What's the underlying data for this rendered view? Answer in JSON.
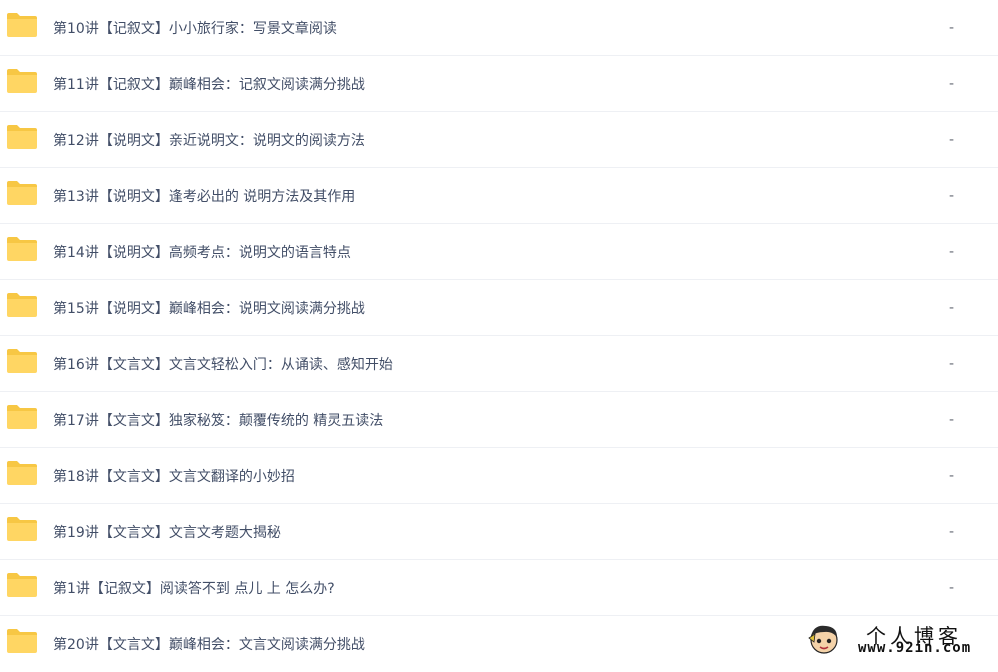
{
  "colors": {
    "folder_body": "#FFD663",
    "folder_tab": "#F7C744",
    "text": "#424E67",
    "row_divider": "#EEF0F4"
  },
  "files": [
    {
      "icon": "folder-icon",
      "name": "第10讲【记叙文】小小旅行家：写景文章阅读",
      "size": "-"
    },
    {
      "icon": "folder-icon",
      "name": "第11讲【记叙文】巅峰相会：记叙文阅读满分挑战",
      "size": "-"
    },
    {
      "icon": "folder-icon",
      "name": "第12讲【说明文】亲近说明文：说明文的阅读方法",
      "size": "-"
    },
    {
      "icon": "folder-icon",
      "name": "第13讲【说明文】逢考必出的 说明方法及其作用",
      "size": "-"
    },
    {
      "icon": "folder-icon",
      "name": "第14讲【说明文】高频考点：说明文的语言特点",
      "size": "-"
    },
    {
      "icon": "folder-icon",
      "name": "第15讲【说明文】巅峰相会：说明文阅读满分挑战",
      "size": "-"
    },
    {
      "icon": "folder-icon",
      "name": "第16讲【文言文】文言文轻松入门：从诵读、感知开始",
      "size": "-"
    },
    {
      "icon": "folder-icon",
      "name": "第17讲【文言文】独家秘笈：颠覆传统的 精灵五读法",
      "size": "-"
    },
    {
      "icon": "folder-icon",
      "name": "第18讲【文言文】文言文翻译的小妙招",
      "size": "-"
    },
    {
      "icon": "folder-icon",
      "name": "第19讲【文言文】文言文考题大揭秘",
      "size": "-"
    },
    {
      "icon": "folder-icon",
      "name": "第1讲【记叙文】阅读答不到 点儿 上 怎么办?",
      "size": "-"
    },
    {
      "icon": "folder-icon",
      "name": "第20讲【文言文】巅峰相会：文言文阅读满分挑战",
      "size": ""
    }
  ],
  "watermark": {
    "title": "个人博客",
    "url": "www.92in.com",
    "mascot_icon": "mascot-icon"
  }
}
